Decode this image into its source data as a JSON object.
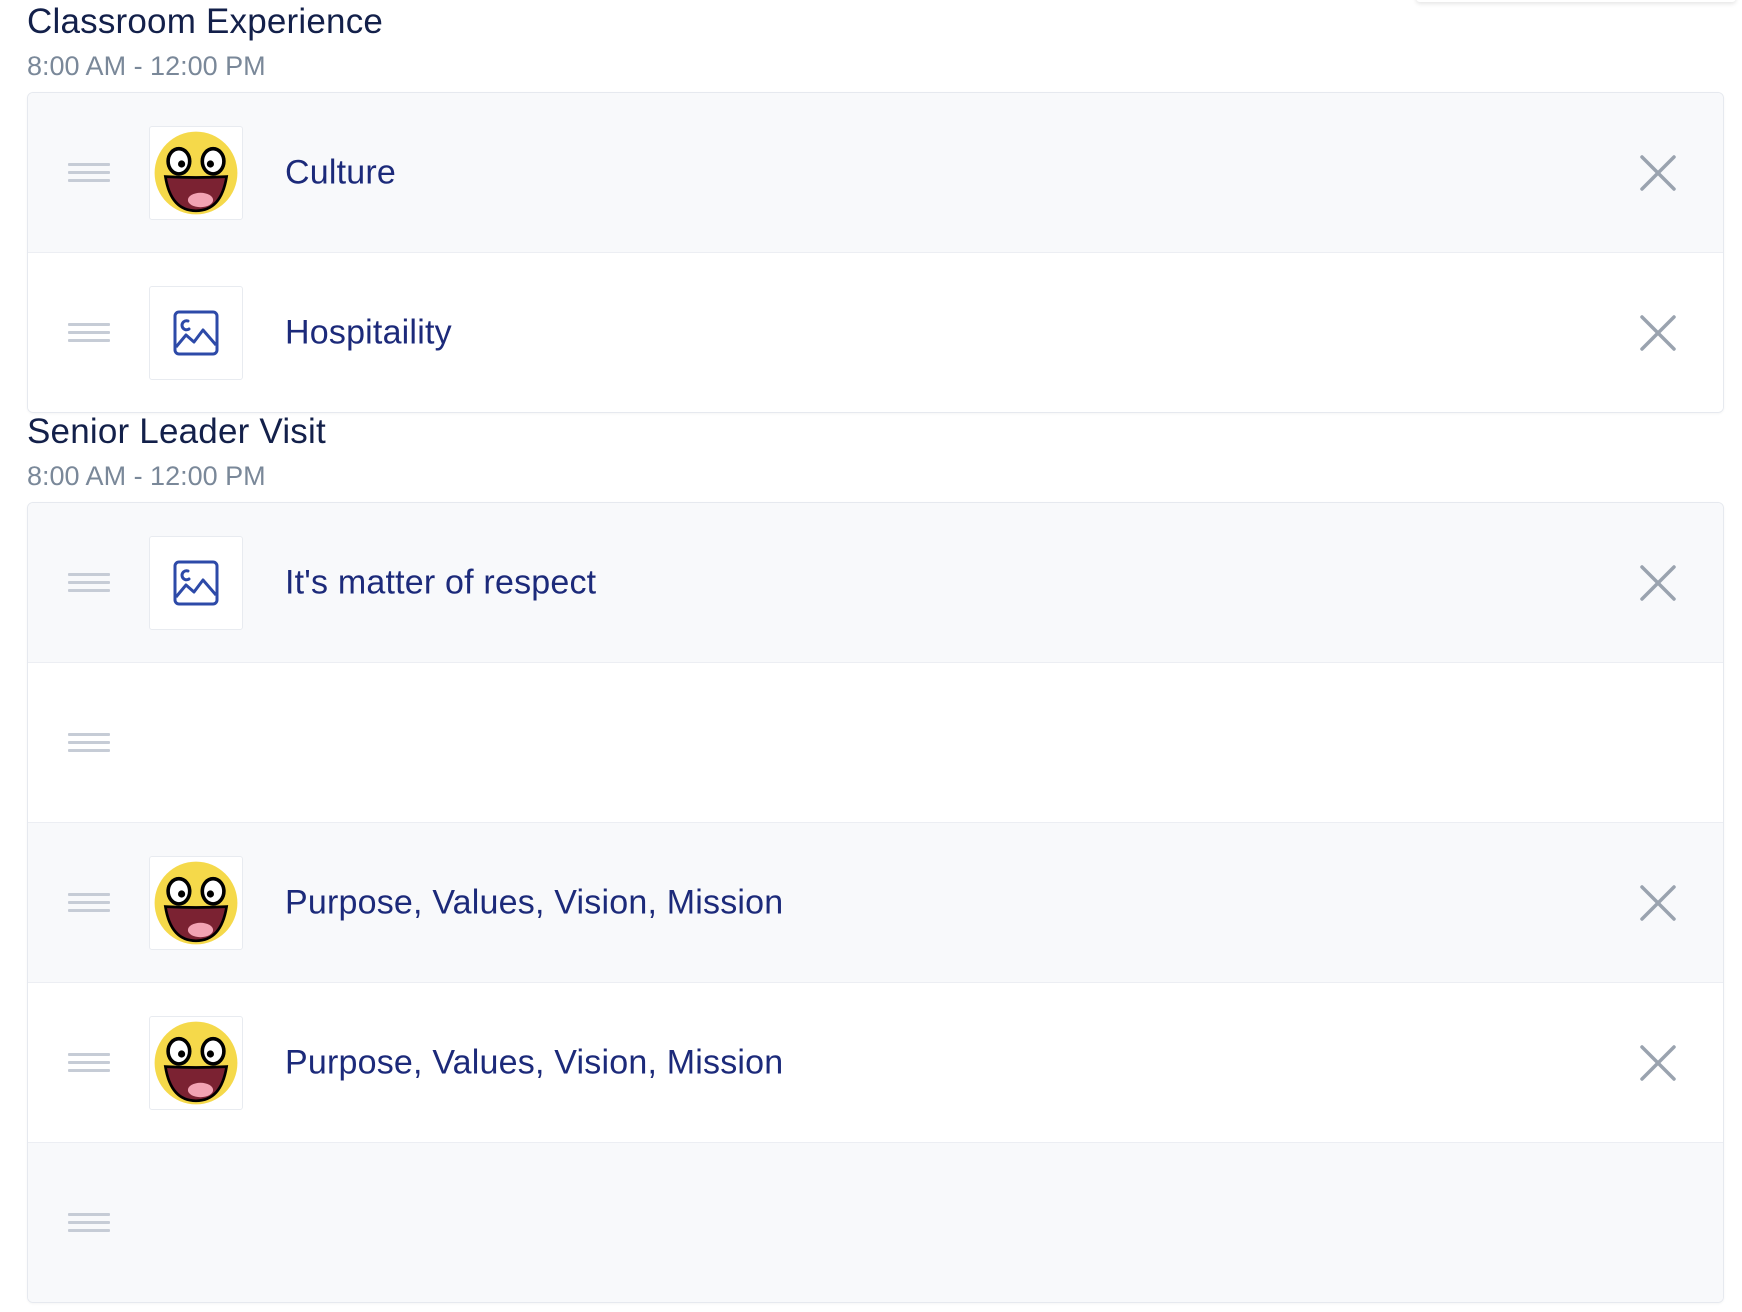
{
  "sections": [
    {
      "title": "Classroom Experience",
      "time": "8:00 AM - 12:00 PM",
      "items": [
        {
          "label": "Culture",
          "thumbnail": "smiley-face-icon"
        },
        {
          "label": "Hospitaility",
          "thumbnail": "image-placeholder-icon"
        }
      ]
    },
    {
      "title": "Senior Leader Visit",
      "time": "8:00 AM - 12:00 PM",
      "items": [
        {
          "label": "It's matter of respect",
          "thumbnail": "image-placeholder-icon"
        },
        {
          "label": "",
          "thumbnail": ""
        },
        {
          "label": "Purpose, Values, Vision, Mission",
          "thumbnail": "smiley-face-icon"
        },
        {
          "label": "Purpose, Values, Vision, Mission",
          "thumbnail": "smiley-face-icon"
        },
        {
          "label": "",
          "thumbnail": ""
        }
      ]
    }
  ],
  "colors": {
    "title": "#13204a",
    "time": "#7a8899",
    "item_label": "#1c2a7a",
    "row_shaded": "#f8f9fb",
    "icon_accent": "#2d4aa8",
    "close_icon": "#9aa3af"
  },
  "icons": {
    "drag": "drag-handle-icon",
    "close": "close-icon",
    "placeholder": "image-placeholder-icon",
    "smiley": "smiley-face-icon"
  }
}
